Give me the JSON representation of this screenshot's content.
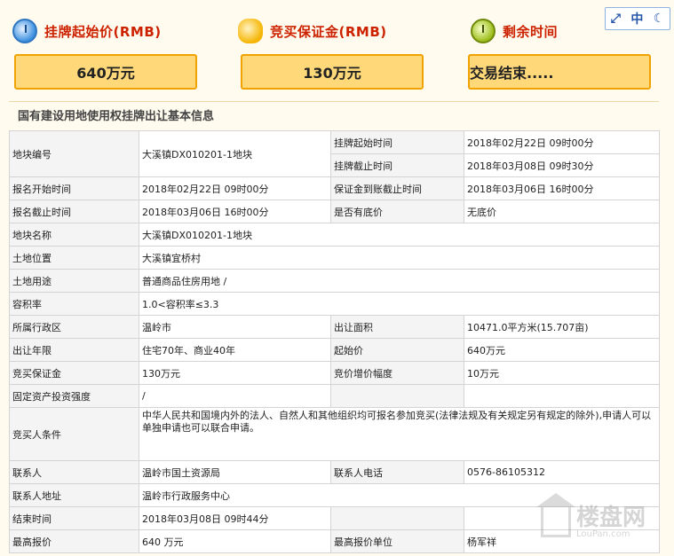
{
  "header": {
    "start_price_label": "挂牌起始价(RMB)",
    "deposit_label": "竞买保证金(RMB)",
    "remaining_label": "剩余时间",
    "start_price_value": "640万元",
    "deposit_value": "130万元",
    "remaining_value": "交易结束....."
  },
  "lang": {
    "zh": "中"
  },
  "section_title": "国有建设用地使用权挂牌出让基本信息",
  "table": {
    "parcel_no_k": "地块编号",
    "parcel_no_v": "大溪镇DX010201-1地块",
    "list_start_k": "挂牌起始时间",
    "list_start_v": "2018年02月22日 09时00分",
    "list_end_k": "挂牌截止时间",
    "list_end_v": "2018年03月08日 09时30分",
    "reg_start_k": "报名开始时间",
    "reg_start_v": "2018年02月22日 09时00分",
    "deposit_deadline_k": "保证金到账截止时间",
    "deposit_deadline_v": "2018年03月06日 16时00分",
    "reg_end_k": "报名截止时间",
    "reg_end_v": "2018年03月06日 16时00分",
    "reserve_k": "是否有底价",
    "reserve_v": "无底价",
    "name_k": "地块名称",
    "name_v": "大溪镇DX010201-1地块",
    "location_k": "土地位置",
    "location_v": "大溪镇宜桥村",
    "use_k": "土地用途",
    "use_v": "普通商品住房用地 /",
    "far_k": "容积率",
    "far_v": "1.0<容积率≤3.3",
    "district_k": "所属行政区",
    "district_v": "温岭市",
    "area_k": "出让面积",
    "area_v": "10471.0平方米(15.707亩)",
    "term_k": "出让年限",
    "term_v": "住宅70年、商业40年",
    "start_price_k": "起始价",
    "start_price_v": "640万元",
    "deposit_k": "竞买保证金",
    "deposit_v": "130万元",
    "increment_k": "竞价增价幅度",
    "increment_v": "10万元",
    "invest_k": "固定资产投资强度",
    "invest_v": "/",
    "cond_k": "竞买人条件",
    "cond_v": "中华人民共和国境内外的法人、自然人和其他组织均可报名参加竞买(法律法规及有关规定另有规定的除外),申请人可以单独申请也可以联合申请。",
    "contact_k": "联系人",
    "contact_v": "温岭市国土资源局",
    "phone_k": "联系人电话",
    "phone_v": "0576-86105312",
    "address_k": "联系人地址",
    "address_v": "温岭市行政服务中心",
    "end_time_k": "结束时间",
    "end_time_v": "2018年03月08日 09时44分",
    "top_bid_k": "最高报价",
    "top_bid_v": "640 万元",
    "top_bidder_k": "最高报价单位",
    "top_bidder_v": "杨军祥"
  },
  "watermark": {
    "main": "楼盘网",
    "sub": "LouPan.com"
  }
}
